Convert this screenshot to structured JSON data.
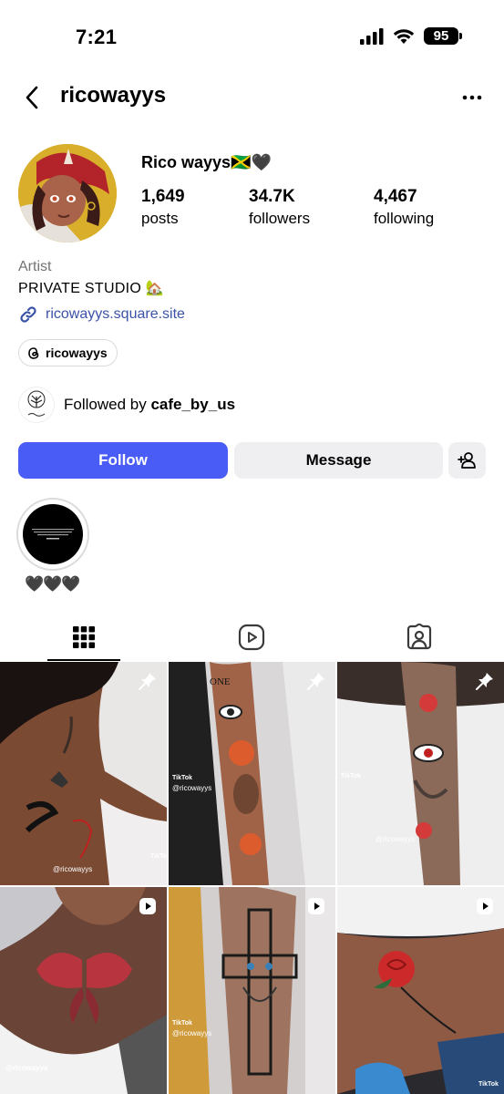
{
  "status_bar": {
    "time": "7:21",
    "battery": "95"
  },
  "header": {
    "username": "ricowayys"
  },
  "profile": {
    "display_name": "Rico wayys🇯🇲🖤",
    "stats": [
      {
        "value": "1,649",
        "label": "posts"
      },
      {
        "value": "34.7K",
        "label": "followers"
      },
      {
        "value": "4,467",
        "label": "following"
      }
    ],
    "category": "Artist",
    "bio": "PRIVATE STUDIO 🏡",
    "link": "ricowayys.square.site",
    "threads_handle": "ricowayys",
    "followed_by_prefix": "Followed by ",
    "followed_by_user": "cafe_by_us"
  },
  "actions": {
    "follow": "Follow",
    "message": "Message"
  },
  "highlights": [
    {
      "label": "🖤🖤🖤"
    }
  ],
  "tabs": [
    "posts-grid",
    "reels",
    "tagged"
  ],
  "grid": {
    "posts": [
      {
        "badge": "pin-icon",
        "caption": "@ricowayys"
      },
      {
        "badge": "pin-icon",
        "caption": "@ricowayys"
      },
      {
        "badge": "pin-icon",
        "caption": "@ricowayys"
      },
      {
        "badge": "reel-icon",
        "caption": "@ricowayys"
      },
      {
        "badge": "reel-icon",
        "caption": "@ricowayys"
      },
      {
        "badge": "reel-icon",
        "caption": ""
      }
    ],
    "tiktok_label": "TikTok"
  },
  "colors": {
    "follow_button": "#4a5cf6",
    "link": "#3a52a6",
    "secondary_button": "#efeff2"
  }
}
